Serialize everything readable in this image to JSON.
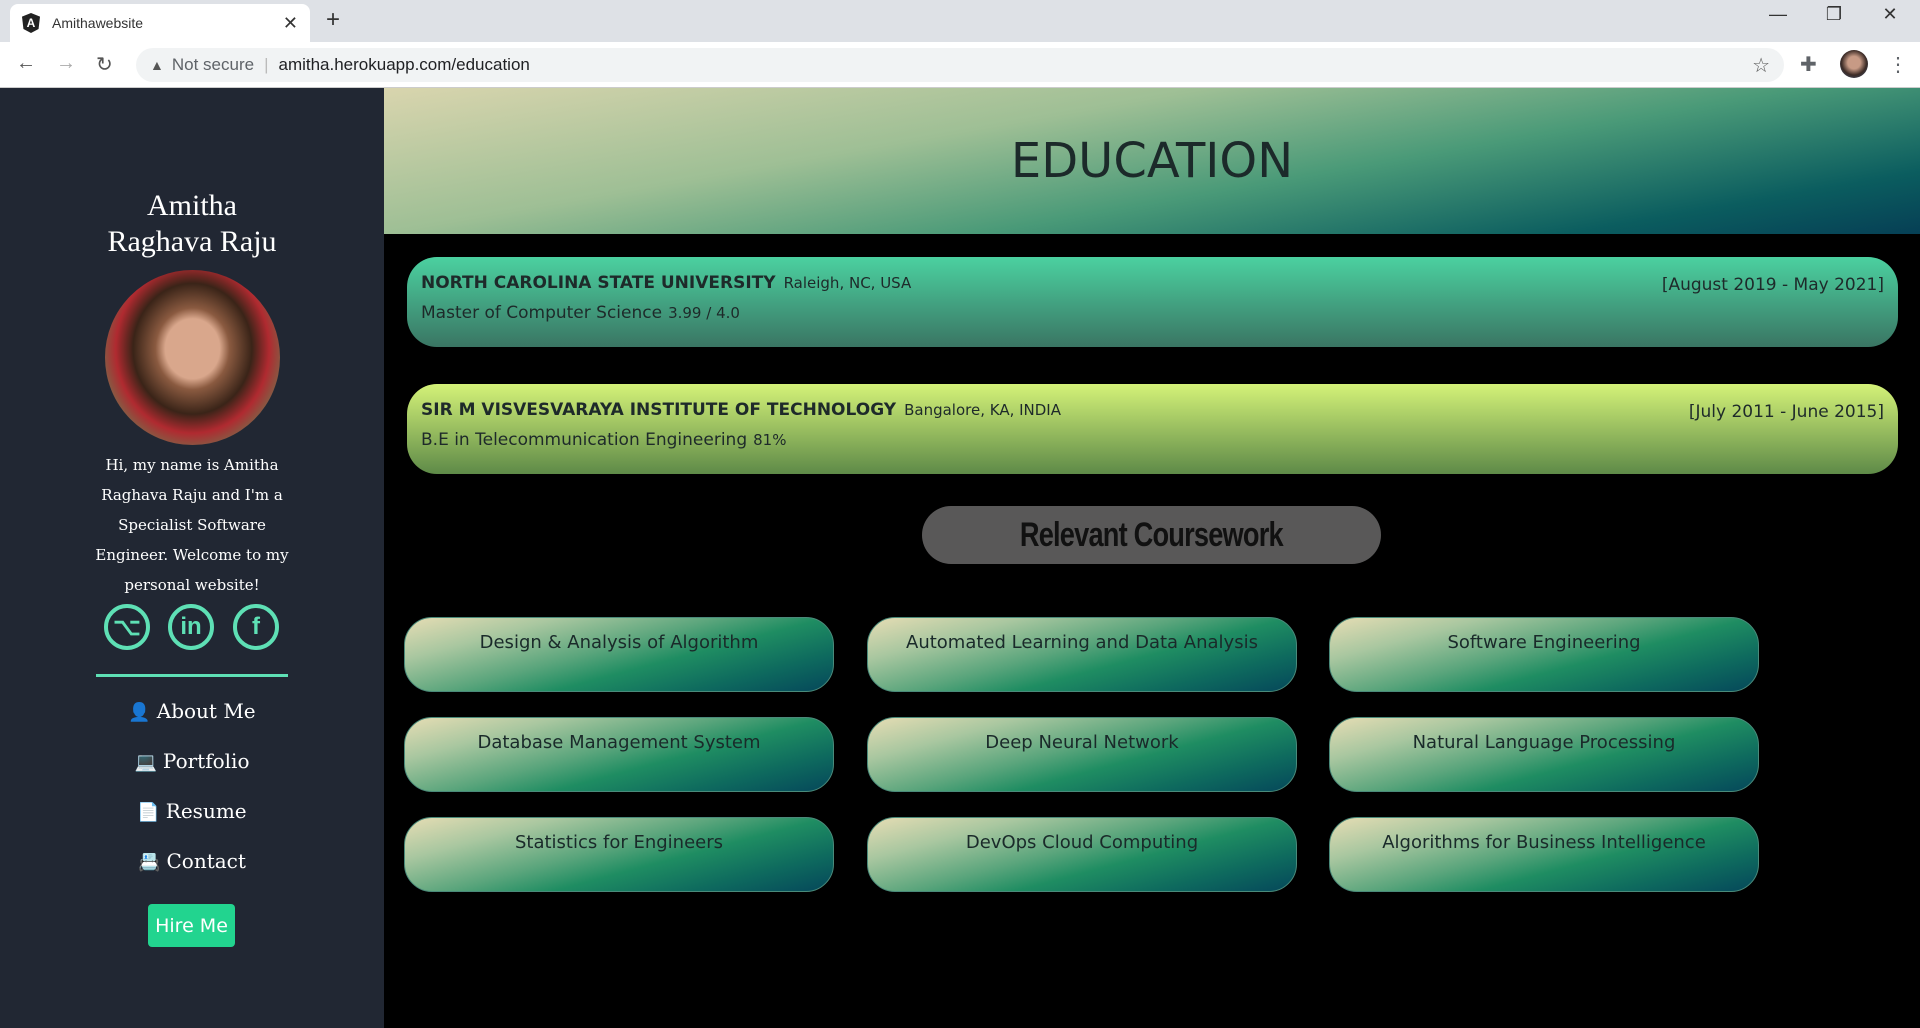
{
  "browser": {
    "tab_title": "Amithawebsite",
    "security": "Not secure",
    "url": "amitha.herokuapp.com/education"
  },
  "sidebar": {
    "name_line1": "Amitha",
    "name_line2": "Raghava Raju",
    "bio": "Hi, my name is Amitha Raghava Raju and I'm a Specialist Software Engineer. Welcome to my personal website!",
    "nav": [
      {
        "label": "About Me",
        "icon": "user-icon"
      },
      {
        "label": "Portfolio",
        "icon": "laptop-icon"
      },
      {
        "label": "Resume",
        "icon": "file-icon"
      },
      {
        "label": "Contact",
        "icon": "address-book-icon"
      }
    ],
    "hire_label": "Hire Me",
    "accent": "#5ee0b5"
  },
  "main": {
    "title": "EDUCATION",
    "education": [
      {
        "school": "NORTH CAROLINA STATE UNIVERSITY",
        "location": "Raleigh, NC, USA",
        "dates": "[August 2019 - May 2021]",
        "degree": "Master of Computer Science",
        "score": "3.99 / 4.0"
      },
      {
        "school": "SIR M VISVESVARAYA INSTITUTE OF TECHNOLOGY",
        "location": "Bangalore, KA, INDIA",
        "dates": "[July 2011 - June 2015]",
        "degree": "B.E in Telecommunication Engineering",
        "score": "81%"
      }
    ],
    "coursework_title": "Relevant Coursework",
    "courses": [
      "Design & Analysis of Algorithm",
      "Automated Learning and Data Analysis",
      "Software Engineering",
      "Database Management System",
      "Deep Neural Network",
      "Natural Language Processing",
      "Statistics for Engineers",
      "DevOps Cloud Computing",
      "Algorithms for Business Intelligence"
    ]
  }
}
